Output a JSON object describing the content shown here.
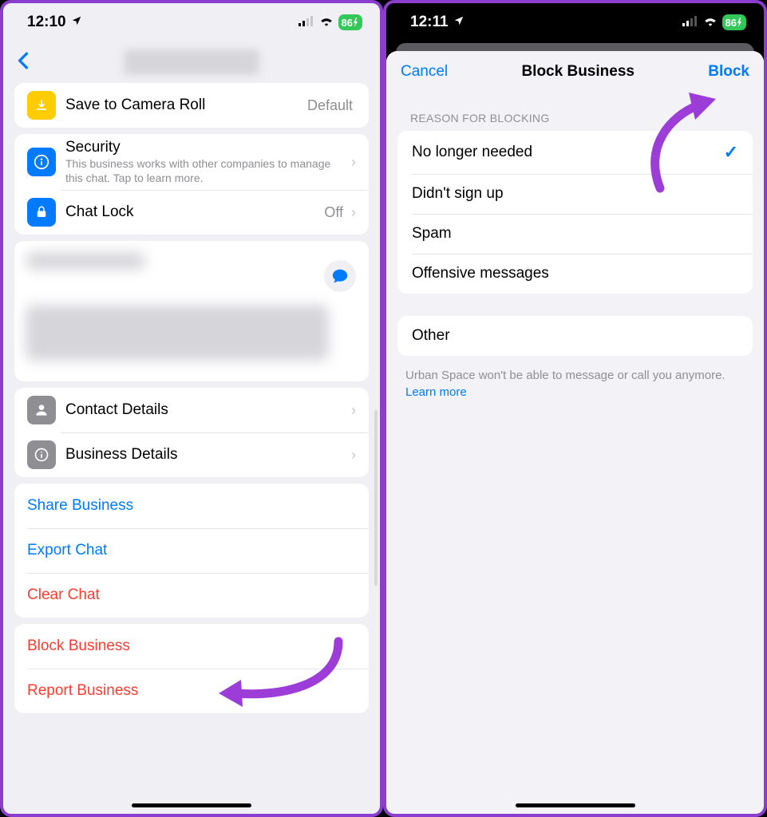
{
  "left": {
    "status": {
      "time": "12:10",
      "battery": "86"
    },
    "rows": {
      "save_label": "Save to Camera Roll",
      "save_value": "Default",
      "security_title": "Security",
      "security_sub": "This business works with other companies to manage this chat. Tap to learn more.",
      "chatlock_label": "Chat Lock",
      "chatlock_value": "Off",
      "contact_details": "Contact Details",
      "business_details": "Business Details",
      "share_business": "Share Business",
      "export_chat": "Export Chat",
      "clear_chat": "Clear Chat",
      "block_business": "Block Business",
      "report_business": "Report Business"
    }
  },
  "right": {
    "status": {
      "time": "12:11",
      "battery": "86"
    },
    "sheet": {
      "cancel": "Cancel",
      "title": "Block Business",
      "action": "Block",
      "section_header": "Reason for Blocking",
      "reasons": {
        "r0": "No longer needed",
        "r1": "Didn't sign up",
        "r2": "Spam",
        "r3": "Offensive messages"
      },
      "other": "Other",
      "note_prefix": "Urban Space won't be able to message or call you anymore. ",
      "note_link": "Learn more"
    }
  }
}
